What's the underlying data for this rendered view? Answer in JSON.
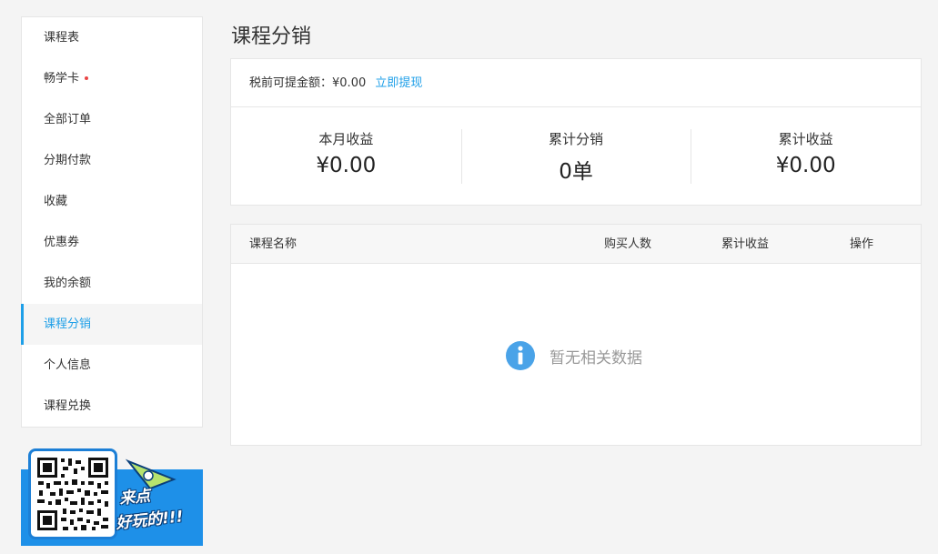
{
  "sidebar": {
    "items": [
      {
        "label": "课程表"
      },
      {
        "label": "畅学卡"
      },
      {
        "label": "全部订单"
      },
      {
        "label": "分期付款"
      },
      {
        "label": "收藏"
      },
      {
        "label": "优惠券"
      },
      {
        "label": "我的余额"
      },
      {
        "label": "课程分销"
      },
      {
        "label": "个人信息"
      },
      {
        "label": "课程兑换"
      }
    ]
  },
  "promo": {
    "line1": "来点",
    "line2": "好玩的!!!"
  },
  "page": {
    "title": "课程分销"
  },
  "earnings": {
    "withdrawable_label": "税前可提金额：",
    "withdrawable_value": "¥0.00",
    "withdraw_link": "立即提现",
    "stats": [
      {
        "label": "本月收益",
        "value": "¥0.00"
      },
      {
        "label": "累计分销",
        "value": "0单"
      },
      {
        "label": "累计收益",
        "value": "¥0.00"
      }
    ]
  },
  "table": {
    "columns": [
      "课程名称",
      "购买人数",
      "累计收益",
      "操作"
    ],
    "empty_text": "暂无相关数据"
  },
  "colors": {
    "accent": "#1e9fe8",
    "dot": "#e94545",
    "background": "#f4f4f4",
    "info_icon": "#4aa3e8"
  }
}
